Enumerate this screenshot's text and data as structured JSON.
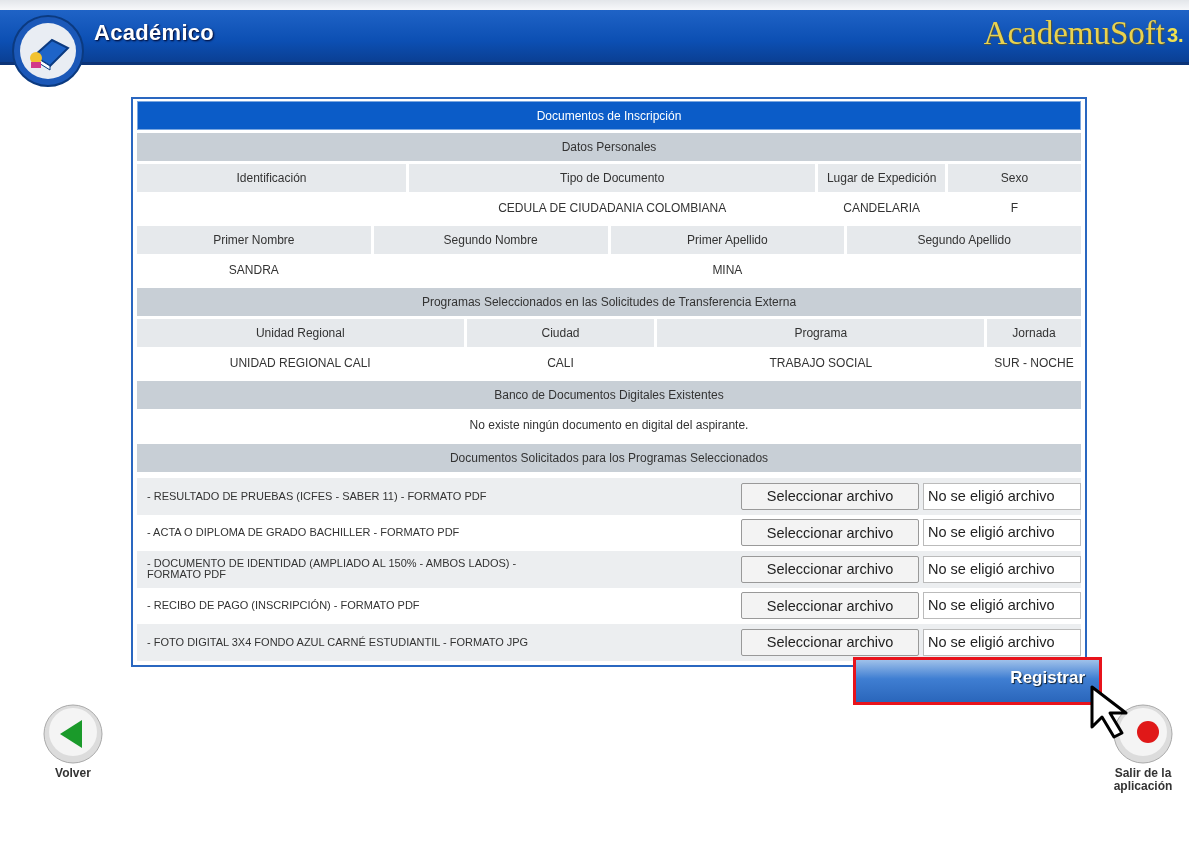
{
  "header": {
    "title": "Académico",
    "logo_text": "AcademuSoft",
    "logo_version": "3."
  },
  "panel": {
    "title": "Documentos de Inscripción",
    "sections": [
      {
        "kind": "fields",
        "heading": "Datos Personales",
        "groups": [
          [
            {
              "label": "Identificación"
            },
            {
              "label": "Tipo de Documento",
              "value": "CEDULA DE CIUDADANIA COLOMBIANA"
            },
            {
              "label": "Lugar de Expedición",
              "value": "CANDELARIA"
            },
            {
              "label": "Sexo",
              "value": "F"
            }
          ],
          [
            {
              "label": "Primer Nombre",
              "value": "SANDRA"
            },
            {
              "label": "Segundo Nombre"
            },
            {
              "label": "Primer Apellido",
              "value": "MINA"
            },
            {
              "label": "Segundo Apellido"
            }
          ]
        ]
      },
      {
        "kind": "fields",
        "heading": "Programas Seleccionados en las Solicitudes de Transferencia Externa",
        "groups": [
          [
            {
              "label": "Unidad Regional",
              "value": "UNIDAD REGIONAL CALI"
            },
            {
              "label": "Ciudad",
              "value": "CALI"
            },
            {
              "label": "Programa",
              "value": "TRABAJO SOCIAL"
            },
            {
              "label": "Jornada",
              "value": "SUR - NOCHE"
            }
          ]
        ]
      },
      {
        "kind": "message",
        "heading": "Banco de Documentos Digitales Existentes",
        "text": "No existe ningún documento en digital del aspirante."
      },
      {
        "kind": "uploads",
        "heading": "Documentos Solicitados para los Programas Seleccionados",
        "items": [
          {
            "label": "- RESULTADO DE PRUEBAS (ICFES - SABER 11) - FORMATO PDF",
            "button": "Seleccionar archivo",
            "status": "No se eligió archivo"
          },
          {
            "label": "- ACTA O DIPLOMA DE GRADO BACHILLER - FORMATO PDF",
            "button": "Seleccionar archivo",
            "status": "No se eligió archivo"
          },
          {
            "label": "- DOCUMENTO DE IDENTIDAD (AMPLIADO AL 150% - AMBOS LADOS) - FORMATO PDF",
            "button": "Seleccionar archivo",
            "status": "No se eligió archivo"
          },
          {
            "label": "- RECIBO DE PAGO (INSCRIPCIÓN) - FORMATO PDF",
            "button": "Seleccionar archivo",
            "status": "No se eligió archivo"
          },
          {
            "label": "- FOTO DIGITAL 3X4 FONDO AZUL CARNÉ ESTUDIANTIL - FORMATO JPG",
            "button": "Seleccionar archivo",
            "status": "No se eligió archivo"
          }
        ]
      }
    ]
  },
  "submit": {
    "label": "Registrar",
    "highlighted": true
  },
  "nav": [
    {
      "kind": "back",
      "label": "Volver"
    },
    {
      "kind": "exit",
      "label": "Salir de la aplicación"
    }
  ]
}
